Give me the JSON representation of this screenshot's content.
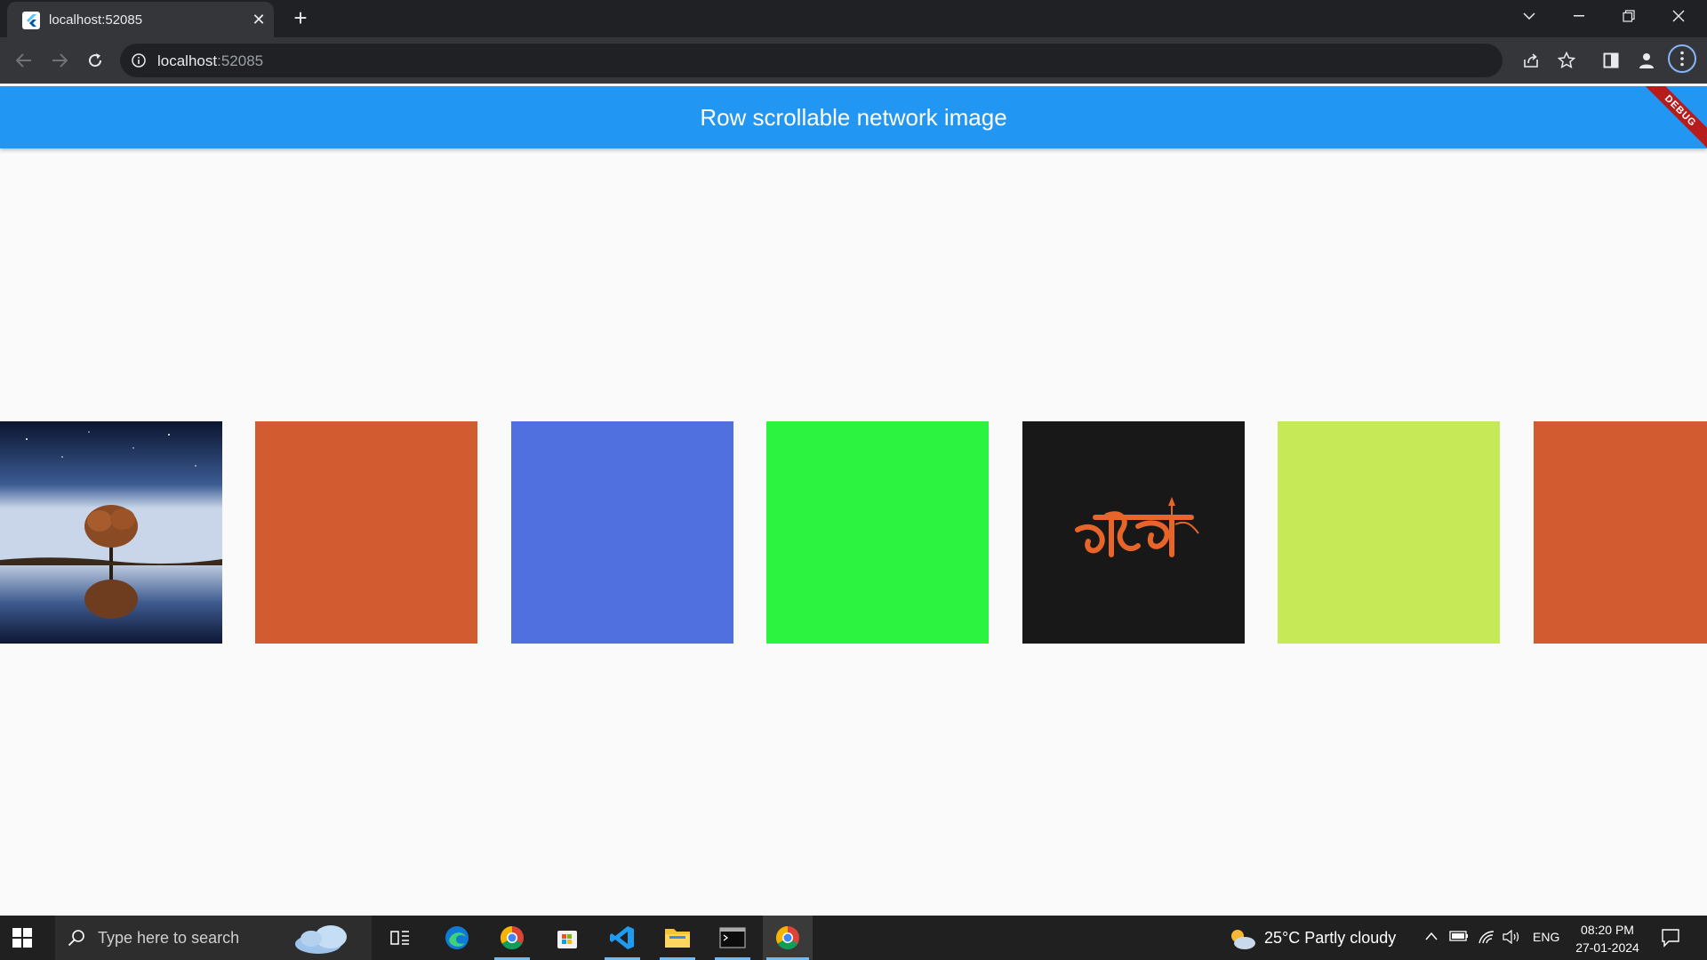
{
  "browser": {
    "tab_title": "localhost:52085",
    "url_host": "localhost",
    "url_port": ":52085",
    "close_glyph": "✕",
    "newtab_glyph": "+"
  },
  "app": {
    "title": "Row scrollable network image",
    "debug_label": "DEBUG",
    "appbar_color": "#2196f3",
    "images": [
      {
        "kind": "photo-tree-night"
      },
      {
        "kind": "solid",
        "color": "#d35b30"
      },
      {
        "kind": "solid",
        "color": "#4f70de"
      },
      {
        "kind": "solid",
        "color": "#2bf33f"
      },
      {
        "kind": "logo-dark"
      },
      {
        "kind": "solid",
        "color": "#c5e957"
      },
      {
        "kind": "solid",
        "color": "#d35b30"
      }
    ]
  },
  "taskbar": {
    "search_placeholder": "Type here to search",
    "weather": "25°C  Partly cloudy",
    "language": "ENG",
    "time": "08:20 PM",
    "date": "27-01-2024"
  }
}
